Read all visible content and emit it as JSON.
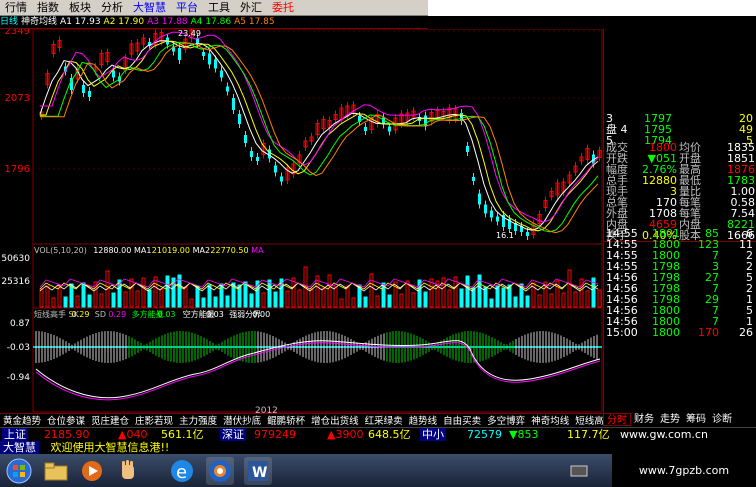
{
  "menu": [
    {
      "label": "行情",
      "style": ""
    },
    {
      "label": "指数",
      "style": ""
    },
    {
      "label": "板块",
      "style": ""
    },
    {
      "label": "分析",
      "style": ""
    },
    {
      "label": "大智慧",
      "style": "blue"
    },
    {
      "label": "平台",
      "style": "blue"
    },
    {
      "label": "工具",
      "style": ""
    },
    {
      "label": "外汇",
      "style": ""
    },
    {
      "label": "委托",
      "style": "red"
    }
  ],
  "info_strip": [
    {
      "text": "日线",
      "color": "#00ffff"
    },
    {
      "text": "神奇均线",
      "color": "#ffffff"
    },
    {
      "text": "A1 17.93",
      "color": "#ffffff"
    },
    {
      "text": "A2 17.90",
      "color": "#ffff00"
    },
    {
      "text": "A3 17.88",
      "color": "#ff00ff"
    },
    {
      "text": "A4 17.86",
      "color": "#00ff00"
    },
    {
      "text": "A5 17.85",
      "color": "#ff8000"
    }
  ],
  "main_axis": {
    "ticks": [
      "2349",
      "2073",
      "1796"
    ]
  },
  "chart_labels": {
    "peak": "23.49",
    "bottom": "16.1"
  },
  "volume": {
    "legend": [
      {
        "text": "VOL(5,10,20)",
        "color": "#c0c0c0"
      },
      {
        "text": "12880.00",
        "color": "#ffffff"
      },
      {
        "text": "MA1",
        "color": "#ffffff"
      },
      {
        "text": "21019.00",
        "color": "#ffff00"
      },
      {
        "text": "MA2",
        "color": "#ffffff"
      },
      {
        "text": "22770.50",
        "color": "#ffff00"
      },
      {
        "text": "MA",
        "color": "#ff00ff"
      }
    ],
    "ticks": [
      "50630",
      "25316"
    ]
  },
  "indicator": {
    "legend": [
      {
        "text": "短线高手 SK",
        "color": "#c0c0c0"
      },
      {
        "text": "0.29",
        "color": "#ffff00"
      },
      {
        "text": "SD",
        "color": "#c0c0c0"
      },
      {
        "text": "0.29",
        "color": "#ff00ff"
      },
      {
        "text": "多方能量",
        "color": "#00ff00"
      },
      {
        "text": "-0.03",
        "color": "#00ff00"
      },
      {
        "text": "空方能量",
        "color": "#ffffff"
      },
      {
        "text": "0.03",
        "color": "#ffffff"
      },
      {
        "text": "强弱分界",
        "color": "#ffffff"
      },
      {
        "text": "0.00",
        "color": "#ffffff"
      }
    ],
    "ticks": [
      "0.87",
      "-0.03",
      "-0.94"
    ]
  },
  "time_label": "2012",
  "quote_panel": {
    "top_partial": [
      {
        "label": "3",
        "price": "1797",
        "vol": "20"
      },
      {
        "label": "盘 4",
        "price": "1795",
        "vol": "49"
      },
      {
        "label": "5",
        "price": "1794",
        "vol": "5"
      }
    ],
    "rows": [
      {
        "l1": "成交",
        "v1": "1800",
        "l2": "均价",
        "v2": "1835",
        "c1": "#ff0000",
        "c2": "#ffffff"
      },
      {
        "l1": "开跌",
        "v1": "▼051",
        "l2": "开盘",
        "v2": "1851",
        "c1": "#00ff00",
        "c2": "#ffffff"
      },
      {
        "l1": "幅度",
        "v1": "2.76%",
        "l2": "最高",
        "v2": "1876",
        "c1": "#00ff00",
        "c2": "#ff0000"
      },
      {
        "l1": "总手",
        "v1": "12880",
        "l2": "最低",
        "v2": "1783",
        "c1": "#ffff00",
        "c2": "#00ff00"
      },
      {
        "l1": "现手",
        "v1": "3",
        "l2": "量比",
        "v2": "1.00",
        "c1": "#ffff00",
        "c2": "#ffffff"
      },
      {
        "l1": "总笔",
        "v1": "170",
        "l2": "每笔",
        "v2": "0.58",
        "c1": "#ffffff",
        "c2": "#ffffff"
      },
      {
        "l1": "外盘",
        "v1": "1708",
        "l2": "每笔",
        "v2": "7.54",
        "c1": "#ffffff",
        "c2": "#ffffff"
      },
      {
        "l1": "内盘",
        "v1": "4659",
        "l2": "内盘",
        "v2": "8221",
        "c1": "#ff0000",
        "c2": "#00ff00"
      },
      {
        "l1": "换手",
        "v1": "0.40%",
        "l2": "股本",
        "v2": "1666",
        "c1": "#ffff00",
        "c2": "#ffffff"
      }
    ],
    "trades": [
      {
        "time": "14:55",
        "price": "1801",
        "vol": "85",
        "num": "6"
      },
      {
        "time": "14:55",
        "price": "1800",
        "vol": "123",
        "num": "11"
      },
      {
        "time": "14:55",
        "price": "1800",
        "vol": "7",
        "num": "2"
      },
      {
        "time": "14:55",
        "price": "1798",
        "vol": "3",
        "num": "2"
      },
      {
        "time": "14:56",
        "price": "1798",
        "vol": "27",
        "num": "5"
      },
      {
        "time": "14:56",
        "price": "1798",
        "vol": "7",
        "num": "2"
      },
      {
        "time": "14:56",
        "price": "1798",
        "vol": "29",
        "num": "1"
      },
      {
        "time": "14:56",
        "price": "1800",
        "vol": "7",
        "num": "5"
      },
      {
        "time": "14:56",
        "price": "1800",
        "vol": "7",
        "num": "1"
      },
      {
        "time": "15:00",
        "price": "1800",
        "vol": "170",
        "num": "26"
      }
    ]
  },
  "right_tabs": [
    {
      "label": "分时",
      "active": true
    },
    {
      "label": "财务",
      "active": false
    },
    {
      "label": "走势",
      "active": false
    },
    {
      "label": "筹码",
      "active": false
    },
    {
      "label": "诊断",
      "active": false
    }
  ],
  "indicator_tabs": [
    "黄金趋势",
    "仓位参谋",
    "觅庄建仓",
    "庄影若现",
    "主力强度",
    "潜伏抄底",
    "鲲鹏轿杯",
    "增仓出货线",
    "红采绿卖",
    "趋势线",
    "自由买卖",
    "多空博弈",
    "神奇均线",
    "短线高手"
  ],
  "index_strip": [
    {
      "text": "上证",
      "color": "#ffffff",
      "bg": "#000080"
    },
    {
      "text": "2185.90",
      "color": "#ff0000",
      "bg": ""
    },
    {
      "text": "▲040",
      "color": "#ff0000",
      "bg": ""
    },
    {
      "text": "561.1亿",
      "color": "#ffff00",
      "bg": ""
    },
    {
      "text": "深证",
      "color": "#ffffff",
      "bg": "#000080"
    },
    {
      "text": "979249",
      "color": "#ff0000",
      "bg": ""
    },
    {
      "text": "▲3900",
      "color": "#ff0000",
      "bg": ""
    },
    {
      "text": "648.5亿",
      "color": "#ffff00",
      "bg": ""
    },
    {
      "text": "中小",
      "color": "#ffffff",
      "bg": "#000080"
    },
    {
      "text": "72579",
      "color": "#00ffff",
      "bg": ""
    },
    {
      "text": "▼853",
      "color": "#00ff00",
      "bg": ""
    },
    {
      "text": "117.7亿",
      "color": "#ffff00",
      "bg": ""
    },
    {
      "text": "www.gw.com.cn",
      "color": "#ffffff",
      "bg": ""
    }
  ],
  "message": {
    "label": "大智慧",
    "text": "欢迎使用大智慧信息港!!"
  },
  "watermark": "www.7gpzb.com",
  "colors": {
    "up": "#ff0000",
    "down": "#00ffff",
    "frame": "#800000",
    "ma1": "#ffffff",
    "ma2": "#ffff00",
    "ma3": "#ff00ff",
    "ma4": "#00ff00",
    "ma5": "#ff8000"
  }
}
